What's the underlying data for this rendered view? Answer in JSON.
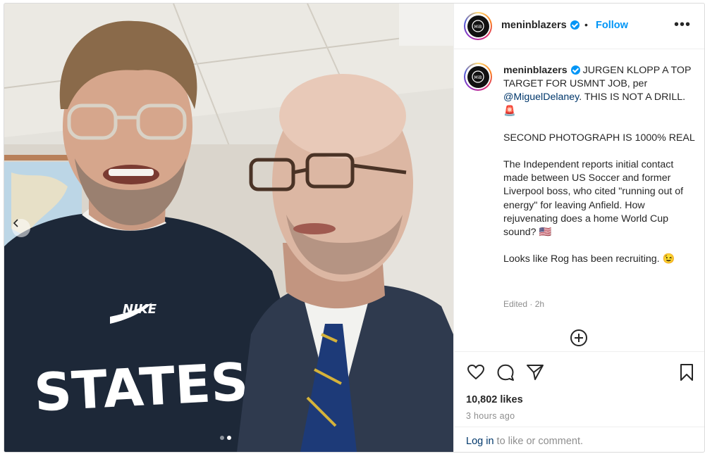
{
  "post": {
    "author": "meninblazers",
    "verified": true,
    "follow_label": "Follow",
    "separator": "•",
    "more_label": "•••",
    "avatar_monogram": "MiB",
    "media": {
      "description_icon": "photo",
      "carousel_total": 2,
      "carousel_active": 2,
      "prev_icon": "chevron-left-icon"
    },
    "caption": {
      "author": "meninblazers",
      "text_before_mention": "JURGEN KLOPP A TOP TARGET FOR USMNT JOB, per ",
      "mention": "@MiguelDelaney",
      "text_after_mention": ". THIS IS NOT A DRILL. 🚨",
      "paragraph_2": "SECOND PHOTOGRAPH IS 1000% REAL",
      "paragraph_3": "The Independent reports initial contact made between US Soccer and former Liverpool boss, who cited \"running out of energy\" for leaving Anfield. How rejuvenating does a home World Cup sound? 🇺🇸",
      "paragraph_4": "Looks like Rog has been recruiting. 😉"
    },
    "edited_label": "Edited · 2h",
    "likes": "10,802 likes",
    "posted_ago": "3 hours ago",
    "login_link": "Log in",
    "login_rest": " to like or comment.",
    "icons": [
      "heart-icon",
      "comment-icon",
      "share-icon",
      "bookmark-icon",
      "add-comment-icon"
    ]
  }
}
